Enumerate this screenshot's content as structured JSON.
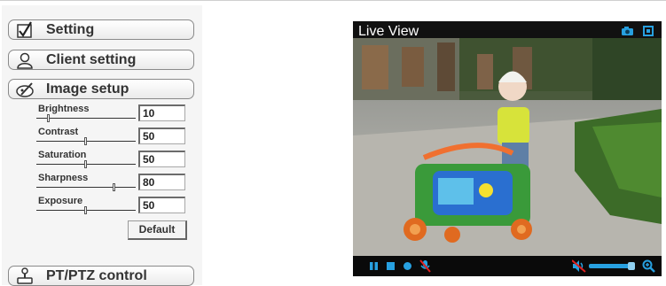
{
  "menu": {
    "setting": "Setting",
    "client_setting": "Client setting",
    "image_setup": "Image setup",
    "ptz_control": "PT/PTZ control"
  },
  "image_setup": {
    "brightness": {
      "label": "Brightness",
      "value": "10"
    },
    "contrast": {
      "label": "Contrast",
      "value": "50"
    },
    "saturation": {
      "label": "Saturation",
      "value": "50"
    },
    "sharpness": {
      "label": "Sharpness",
      "value": "80"
    },
    "exposure": {
      "label": "Exposure",
      "value": "50"
    },
    "default_label": "Default"
  },
  "viewer": {
    "title": "Live View"
  },
  "colors": {
    "accent_blue": "#27a0e0",
    "mute_red": "#e02020"
  },
  "icons": [
    "check-icon",
    "user-icon",
    "image-edit-icon",
    "joystick-icon",
    "camera-icon",
    "fullscreen-icon",
    "pause-icon",
    "stop-icon",
    "record-icon",
    "mic-off-icon",
    "speaker-muted-icon",
    "volume-slider",
    "zoom-icon"
  ]
}
